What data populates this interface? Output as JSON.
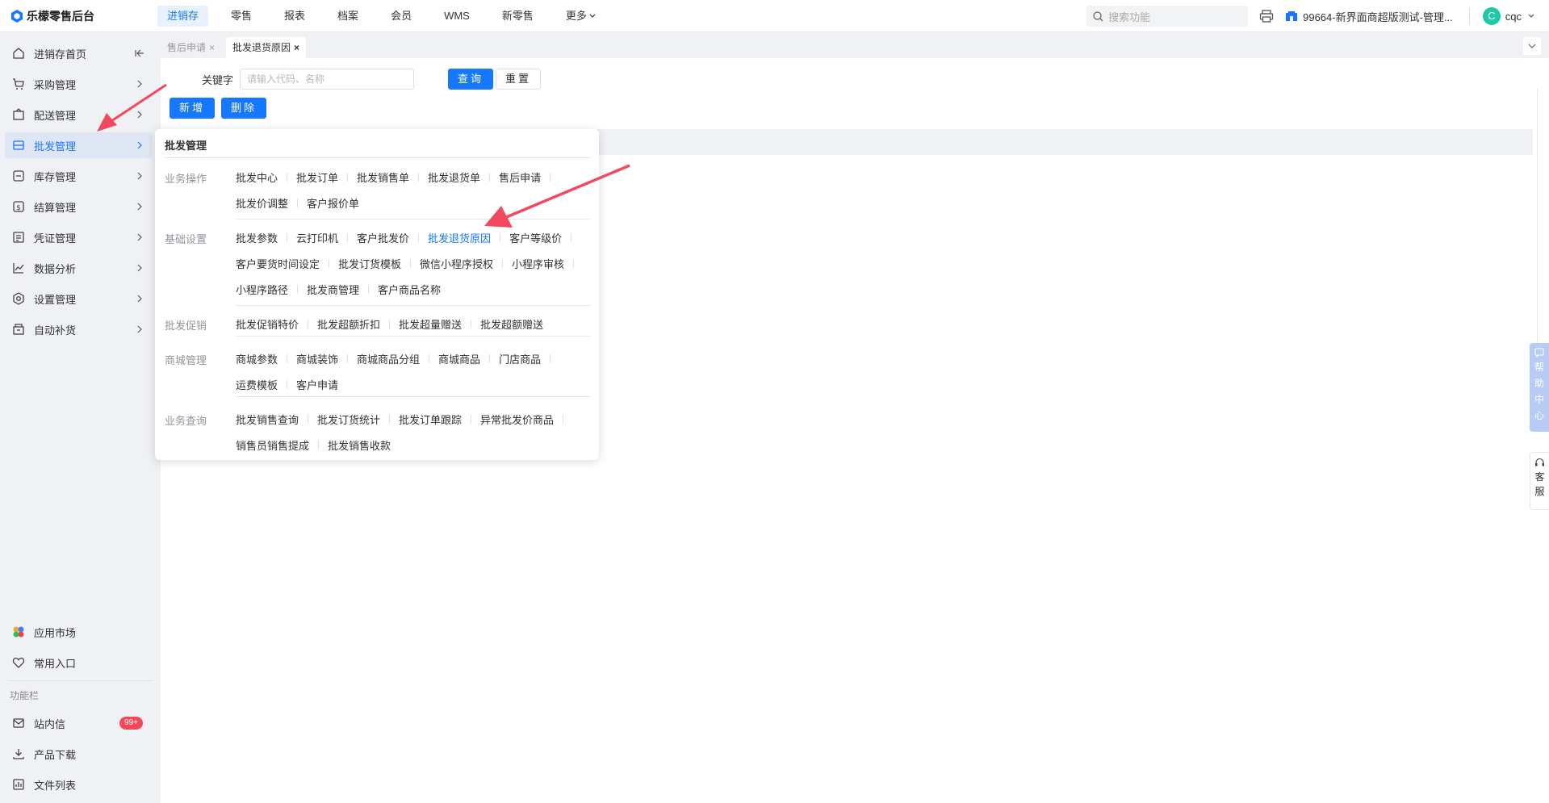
{
  "app": {
    "logo_text": "乐檬零售后台"
  },
  "topnav": [
    "进销存",
    "零售",
    "报表",
    "档案",
    "会员",
    "WMS",
    "新零售",
    "更多"
  ],
  "search": {
    "placeholder": "搜索功能"
  },
  "store": {
    "label": "99664-新界面商超版测试-管理..."
  },
  "user": {
    "avatar_letter": "C",
    "name": "cqc"
  },
  "sidebar": {
    "items": [
      {
        "label": "进销存首页",
        "icon": "home-icon"
      },
      {
        "label": "采购管理",
        "icon": "cart-icon"
      },
      {
        "label": "配送管理",
        "icon": "box-icon"
      },
      {
        "label": "批发管理",
        "icon": "wholesale-icon"
      },
      {
        "label": "库存管理",
        "icon": "inventory-icon"
      },
      {
        "label": "结算管理",
        "icon": "dollar-icon"
      },
      {
        "label": "凭证管理",
        "icon": "voucher-icon"
      },
      {
        "label": "数据分析",
        "icon": "chart-icon"
      },
      {
        "label": "设置管理",
        "icon": "settings-icon"
      },
      {
        "label": "自动补货",
        "icon": "restock-icon"
      }
    ],
    "bottom_items": [
      {
        "label": "应用市场",
        "icon": "app-market-icon"
      },
      {
        "label": "常用入口",
        "icon": "heart-icon"
      }
    ],
    "section_title": "功能栏",
    "func_items": [
      {
        "label": "站内信",
        "icon": "mail-icon",
        "badge": "99+"
      },
      {
        "label": "产品下载",
        "icon": "download-icon"
      },
      {
        "label": "文件列表",
        "icon": "file-list-icon"
      }
    ]
  },
  "tabs": [
    {
      "label": "售后申请",
      "close": "×"
    },
    {
      "label": "批发退货原因",
      "close": "×"
    }
  ],
  "filter": {
    "keyword_label": "关键字",
    "keyword_placeholder": "请输入代码、名称",
    "query": "查询",
    "reset": "重置"
  },
  "actions": {
    "add": "新增",
    "delete": "删除"
  },
  "popup": {
    "title": "批发管理",
    "groups": [
      {
        "name": "业务操作",
        "lines": [
          [
            "批发中心",
            "批发订单",
            "批发销售单",
            "批发退货单",
            "售后申请"
          ],
          [
            "批发价调整",
            "客户报价单"
          ]
        ]
      },
      {
        "name": "基础设置",
        "lines": [
          [
            "批发参数",
            "云打印机",
            "客户批发价",
            "批发退货原因",
            "客户等级价"
          ],
          [
            "客户要货时间设定",
            "批发订货模板",
            "微信小程序授权",
            "小程序审核"
          ],
          [
            "小程序路径",
            "批发商管理",
            "客户商品名称"
          ]
        ]
      },
      {
        "name": "批发促销",
        "lines": [
          [
            "批发促销特价",
            "批发超额折扣",
            "批发超量赠送",
            "批发超额赠送"
          ]
        ]
      },
      {
        "name": "商城管理",
        "lines": [
          [
            "商城参数",
            "商城装饰",
            "商城商品分组",
            "商城商品",
            "门店商品"
          ],
          [
            "运费模板",
            "客户申请"
          ]
        ]
      },
      {
        "name": "业务查询",
        "lines": [
          [
            "批发销售查询",
            "批发订货统计",
            "批发订单跟踪",
            "异常批发价商品"
          ],
          [
            "销售员销售提成",
            "批发销售收款"
          ]
        ]
      }
    ],
    "active_link": "批发退货原因"
  },
  "right_float": {
    "help": [
      "帮",
      "助",
      "中",
      "心"
    ],
    "service": [
      "客",
      "服"
    ]
  },
  "colors": {
    "accent": "#1677ff",
    "arrow": "#f3495f",
    "badge": "#f5475a"
  }
}
